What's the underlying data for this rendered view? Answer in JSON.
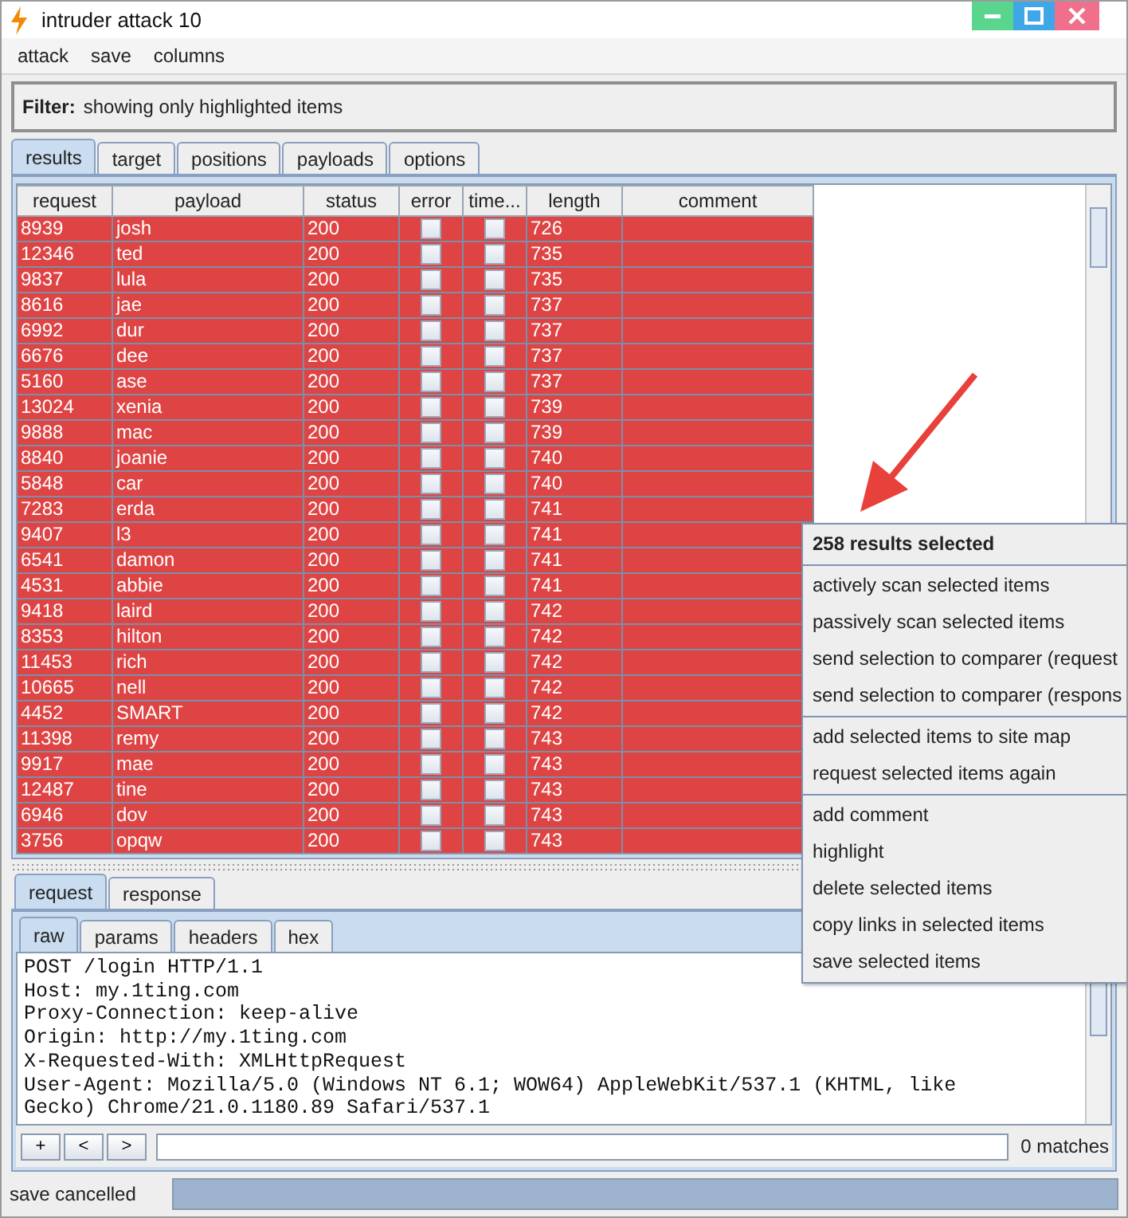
{
  "window": {
    "title": "intruder attack 10"
  },
  "menu": [
    "attack",
    "save",
    "columns"
  ],
  "filter": {
    "label": "Filter:",
    "text": "showing only highlighted items"
  },
  "tabs": [
    {
      "label": "results",
      "selected": true
    },
    {
      "label": "target",
      "selected": false
    },
    {
      "label": "positions",
      "selected": false
    },
    {
      "label": "payloads",
      "selected": false
    },
    {
      "label": "options",
      "selected": false
    }
  ],
  "table": {
    "columns": [
      "request",
      "payload",
      "status",
      "error",
      "time...",
      "length",
      "comment"
    ],
    "rows": [
      {
        "request": "8939",
        "payload": "josh",
        "status": "200",
        "error": false,
        "timeout": false,
        "length": "726",
        "selected": true
      },
      {
        "request": "12346",
        "payload": "ted",
        "status": "200",
        "error": false,
        "timeout": false,
        "length": "735",
        "selected": true
      },
      {
        "request": "9837",
        "payload": "lula",
        "status": "200",
        "error": false,
        "timeout": false,
        "length": "735",
        "selected": true
      },
      {
        "request": "8616",
        "payload": "jae",
        "status": "200",
        "error": false,
        "timeout": false,
        "length": "737",
        "selected": true
      },
      {
        "request": "6992",
        "payload": "dur",
        "status": "200",
        "error": false,
        "timeout": false,
        "length": "737",
        "selected": true
      },
      {
        "request": "6676",
        "payload": "dee",
        "status": "200",
        "error": false,
        "timeout": false,
        "length": "737",
        "selected": true
      },
      {
        "request": "5160",
        "payload": "ase",
        "status": "200",
        "error": false,
        "timeout": false,
        "length": "737",
        "selected": true
      },
      {
        "request": "13024",
        "payload": "xenia",
        "status": "200",
        "error": false,
        "timeout": false,
        "length": "739",
        "selected": true
      },
      {
        "request": "9888",
        "payload": "mac",
        "status": "200",
        "error": false,
        "timeout": false,
        "length": "739",
        "selected": true
      },
      {
        "request": "8840",
        "payload": "joanie",
        "status": "200",
        "error": false,
        "timeout": false,
        "length": "740",
        "selected": true
      },
      {
        "request": "5848",
        "payload": "car",
        "status": "200",
        "error": false,
        "timeout": false,
        "length": "740",
        "selected": true
      },
      {
        "request": "7283",
        "payload": "erda",
        "status": "200",
        "error": false,
        "timeout": false,
        "length": "741",
        "selected": true
      },
      {
        "request": "9407",
        "payload": "l3",
        "status": "200",
        "error": false,
        "timeout": false,
        "length": "741",
        "selected": true
      },
      {
        "request": "6541",
        "payload": "damon",
        "status": "200",
        "error": false,
        "timeout": false,
        "length": "741",
        "selected": true
      },
      {
        "request": "4531",
        "payload": "abbie",
        "status": "200",
        "error": false,
        "timeout": false,
        "length": "741",
        "selected": true
      },
      {
        "request": "9418",
        "payload": "laird",
        "status": "200",
        "error": false,
        "timeout": false,
        "length": "742",
        "selected": true
      },
      {
        "request": "8353",
        "payload": "hilton",
        "status": "200",
        "error": false,
        "timeout": false,
        "length": "742",
        "selected": true
      },
      {
        "request": "11453",
        "payload": "rich",
        "status": "200",
        "error": false,
        "timeout": false,
        "length": "742",
        "selected": true
      },
      {
        "request": "10665",
        "payload": "nell",
        "status": "200",
        "error": false,
        "timeout": false,
        "length": "742",
        "selected": true
      },
      {
        "request": "4452",
        "payload": "SMART",
        "status": "200",
        "error": false,
        "timeout": false,
        "length": "742",
        "selected": true
      },
      {
        "request": "11398",
        "payload": "remy",
        "status": "200",
        "error": false,
        "timeout": false,
        "length": "743",
        "selected": true
      },
      {
        "request": "9917",
        "payload": "mae",
        "status": "200",
        "error": false,
        "timeout": false,
        "length": "743",
        "selected": true
      },
      {
        "request": "12487",
        "payload": "tine",
        "status": "200",
        "error": false,
        "timeout": false,
        "length": "743",
        "selected": true
      },
      {
        "request": "6946",
        "payload": "dov",
        "status": "200",
        "error": false,
        "timeout": false,
        "length": "743",
        "selected": true
      },
      {
        "request": "3756",
        "payload": "opqw",
        "status": "200",
        "error": false,
        "timeout": false,
        "length": "743",
        "selected": true
      }
    ]
  },
  "context_menu": {
    "title": "258 results selected",
    "groups": [
      [
        "actively scan selected items",
        "passively scan selected items",
        "send selection to comparer (request",
        "send selection to comparer (respons"
      ],
      [
        "add selected items to site map",
        "request selected items again"
      ],
      [
        "add comment",
        "highlight",
        "delete selected items",
        "copy links in selected items",
        "save selected items"
      ]
    ]
  },
  "message_tabs": [
    {
      "label": "request",
      "selected": true
    },
    {
      "label": "response",
      "selected": false
    }
  ],
  "view_tabs": [
    {
      "label": "raw",
      "selected": true
    },
    {
      "label": "params",
      "selected": false
    },
    {
      "label": "headers",
      "selected": false
    },
    {
      "label": "hex",
      "selected": false
    }
  ],
  "raw_lines": [
    "POST /login HTTP/1.1",
    "Host: my.1ting.com",
    "Proxy-Connection: keep-alive",
    "Origin: http://my.1ting.com",
    "X-Requested-With: XMLHttpRequest",
    "User-Agent: Mozilla/5.0 (Windows NT 6.1; WOW64) AppleWebKit/537.1 (KHTML, like",
    "Gecko) Chrome/21.0.1180.89 Safari/537.1"
  ],
  "search_bar": {
    "buttons": [
      "+",
      "<",
      ">"
    ],
    "matches": "0 matches"
  },
  "status_bar": {
    "text": "save cancelled",
    "level": 1
  }
}
